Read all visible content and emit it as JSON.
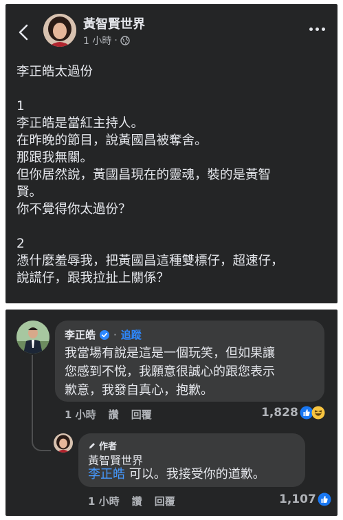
{
  "post": {
    "author": "黃智賢世界",
    "time": "1 小時",
    "dot": "·",
    "lines": [
      "李正皓太過份",
      "",
      "1",
      "李正皓是當紅主持人。",
      "在昨晚的節目，說黃國昌被奪舍。",
      "那跟我無關。",
      "但你居然說，黃國昌現在的靈魂，裝的是黃智",
      "賢。",
      "你不覺得你太過份？",
      "",
      "2",
      "憑什麼羞辱我，把黃國昌這種雙標仔，超速仔，",
      "說謊仔，跟我拉扯上關係？"
    ]
  },
  "comment": {
    "author": "李正皓",
    "dot": "·",
    "follow": "追蹤",
    "lines": [
      "我當場有說是這是一個玩笑，但如果讓",
      "您感到不悅，我願意很誠心的跟您表示",
      "歉意，我發自真心，抱歉。"
    ],
    "time": "1 小時",
    "like": "讚",
    "reply": "回覆",
    "reaction_count": "1,828"
  },
  "reply": {
    "badge": "作者",
    "author": "黃智賢世界",
    "mention": "李正皓",
    "text": " 可以。我接受你的道歉。",
    "time": "1 小時",
    "like": "讚",
    "reply": "回覆",
    "reaction_count": "1,107"
  }
}
